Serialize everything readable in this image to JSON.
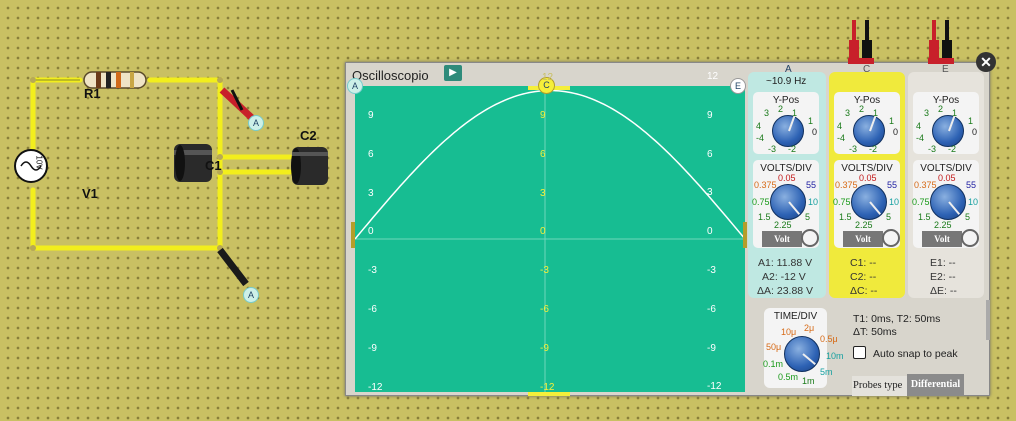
{
  "circuit": {
    "r1_label": "R1",
    "v1_label": "V1",
    "c1_label": "C1",
    "c2_label": "C2",
    "source_text": "10V",
    "probe_a_top": "A",
    "probe_a_bottom": "A"
  },
  "oscilloscope": {
    "title": "Oscilloscopio",
    "cursor_left": "A",
    "cursor_center": "C",
    "cursor_right": "E",
    "y_ticks_left": [
      "9",
      "6",
      "3",
      "0",
      "-3",
      "-6",
      "-9",
      "-12"
    ],
    "y_ticks_center": [
      "9",
      "6",
      "3",
      "0",
      "-3",
      "-6",
      "-9",
      "-12"
    ],
    "y_ticks_right": [
      "12",
      "9",
      "6",
      "3",
      "0",
      "-3",
      "-6",
      "-9",
      "-12"
    ],
    "center_top": "12"
  },
  "channel_a": {
    "tag": "A",
    "freq": "~10.9 Hz",
    "ypos_title": "Y-Pos",
    "volts_title": "VOLTS/DIV",
    "volt_btn": "Volt",
    "m1": "A1: 11.88 V",
    "m2": "A2: -12 V",
    "m3": "ΔA: 23.88 V"
  },
  "channel_c": {
    "tag": "C",
    "ypos_title": "Y-Pos",
    "volts_title": "VOLTS/DIV",
    "volt_btn": "Volt",
    "m1": "C1: --",
    "m2": "C2: --",
    "m3": "ΔC: --"
  },
  "channel_e": {
    "tag": "E",
    "ypos_title": "Y-Pos",
    "volts_title": "VOLTS/DIV",
    "volt_btn": "Volt",
    "m1": "E1: --",
    "m2": "E2: --",
    "m3": "ΔE: --"
  },
  "ypos_scale": {
    "l4": "4",
    "l3": "3",
    "l2": "2",
    "l1": "1",
    "r1": "1",
    "r2": "2",
    "m4": "-4",
    "m3": "-3",
    "m2": "-2",
    "z": "0"
  },
  "volts_scale": {
    "a": "0.375",
    "b": "0.05",
    "c": "55",
    "d": "0.75",
    "e": "10",
    "f": "1.5",
    "g": "5",
    "h": "2.25"
  },
  "timediv": {
    "title": "TIME/DIV",
    "labels": [
      "10μ",
      "2μ",
      "0.5μ",
      "50μ",
      "10m",
      "0.1m",
      "5m",
      "0.5m",
      "1m"
    ]
  },
  "timing": {
    "t_line": "T1: 0ms, T2: 50ms",
    "dt_line": "ΔT: 50ms",
    "auto_snap": "Auto snap to peak",
    "probes_type_label": "Probes type",
    "probes_type_value": "Differential"
  },
  "colors": {
    "screen": "#17bd92",
    "trace": "#ffffff",
    "wire": "#f2ee1c",
    "channel_c": "#f0ea3c"
  }
}
